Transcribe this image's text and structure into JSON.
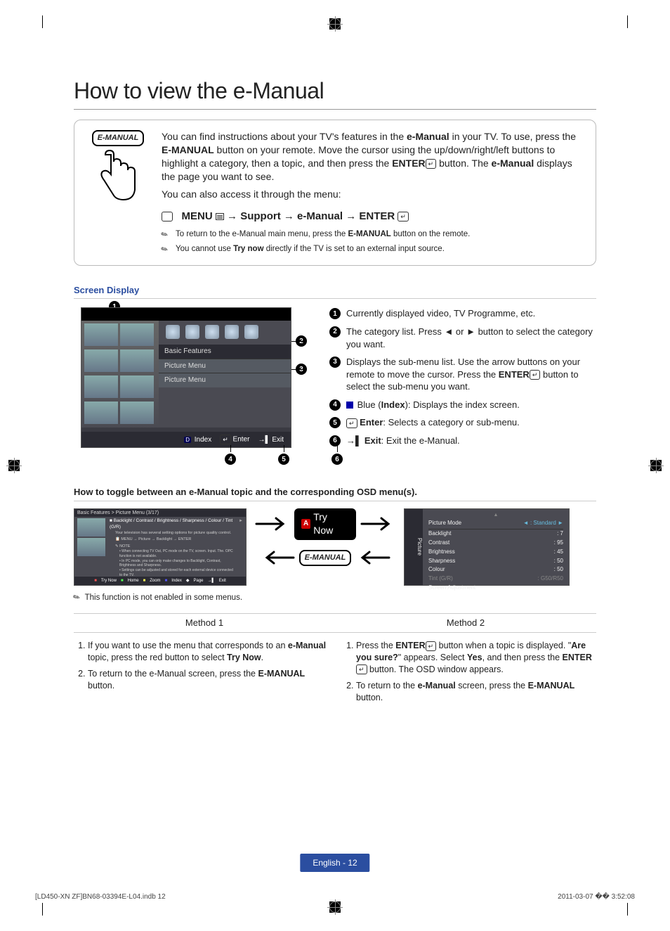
{
  "title": "How to view the e-Manual",
  "emanual_label": "E-MANUAL",
  "intro": {
    "p1_a": "You can find instructions about your TV's features in the ",
    "p1_b": "e-Manual",
    "p1_c": " in your TV. To use, press the ",
    "p1_d": "E-MANUAL",
    "p1_e": " button on your remote. Move the cursor using the up/down/right/left buttons to highlight a category, then a topic, and then press the ",
    "p1_f": "ENTER",
    "p1_g": " button. The ",
    "p1_h": "e-Manual",
    "p1_i": " displays the page you want to see.",
    "p2": "You can also access it through the menu:",
    "path": {
      "menu": "MENU",
      "support": "Support",
      "emanual": "e-Manual",
      "enter": "ENTER"
    },
    "note1_a": "To return to the e-Manual main menu, press the ",
    "note1_b": "E-MANUAL",
    "note1_c": " button on the remote.",
    "note2_a": "You cannot use ",
    "note2_b": "Try now",
    "note2_c": " directly if the TV is set to an external input source."
  },
  "screen_display_h": "Screen Display",
  "mock": {
    "basic": "Basic Features",
    "pm1": "Picture Menu",
    "pm2": "Picture Menu",
    "d": "D",
    "index": "Index",
    "e": "E",
    "enter": "Enter",
    "exit": "Exit"
  },
  "legend": {
    "i1": "Currently displayed video, TV Programme, etc.",
    "i2_a": "The category list. Press ◄ or ► button to select the category you want.",
    "i3_a": "Displays the sub-menu list. Use the arrow buttons on your remote to move the cursor. Press the ",
    "i3_b": "ENTER",
    "i3_c": " button to select the sub-menu you want.",
    "i4_a": "Blue (",
    "i4_b": "Index",
    "i4_c": "): Displays the index screen.",
    "i5_a": "Enter",
    "i5_b": ": Selects a category or sub-menu.",
    "i6_a": "Exit",
    "i6_b": ": Exit the e-Manual."
  },
  "toggle_h": "How to toggle between an e-Manual topic and the corresponding OSD menu(s).",
  "mini": {
    "breadcrumb": "Basic Features > Picture Menu (3/17)",
    "bullets": "Backlight / Contrast / Brightness / Sharpness / Colour / Tint (G/R)",
    "sub": "Your television has several setting options for picture quality control.",
    "path": "MENU → Picture → Backlight → ENTER",
    "note_h": "NOTE",
    "b1": "When connecting TV Out, PC mode on the TV, screen. Input. The. OPC function is not available.",
    "b2": "In PC mode, you can only make changes to Backlight, Contrast, Brightness and Sharpness.",
    "b3": "Settings can be adjusted and stored for each external device connected to the TV.",
    "ft_try": "Try Now",
    "ft_home": "Home",
    "ft_zoom": "Zoom",
    "ft_index": "Index",
    "ft_page": "Page",
    "ft_exit": "Exit"
  },
  "trynow_label": "Try Now",
  "osd": {
    "side": "Picture",
    "mode": "Picture Mode",
    "mode_v": ": Standard",
    "bl": "Backlight",
    "bl_v": ": 7",
    "ct": "Contrast",
    "ct_v": ": 95",
    "br": "Brightness",
    "br_v": ": 45",
    "sh": "Sharpness",
    "sh_v": ": 50",
    "co": "Colour",
    "co_v": ": 50",
    "ti": "Tint (G/R)",
    "ti_v": ": G50/R50",
    "sa": "Screen Adjustment"
  },
  "note3": "This function is not enabled in some menus.",
  "method1_h": "Method 1",
  "method2_h": "Method 2",
  "m1": {
    "s1_a": "If you want to use the menu that corresponds to an ",
    "s1_b": "e-Manual",
    "s1_c": " topic, press the red button to select ",
    "s1_d": "Try Now",
    "s1_e": ".",
    "s2_a": "To return to the e-Manual screen, press the ",
    "s2_b": "E-MANUAL",
    "s2_c": " button."
  },
  "m2": {
    "s1_a": "Press the ",
    "s1_b": "ENTER",
    "s1_c": " button when a topic is displayed. \"",
    "s1_d": "Are you sure?",
    "s1_e": "\" appears. Select ",
    "s1_f": "Yes",
    "s1_g": ", and then press the ",
    "s1_h": "ENTER",
    "s1_i": " button. The OSD window appears.",
    "s2_a": "To return to the ",
    "s2_b": "e-Manual",
    "s2_c": " screen, press the ",
    "s2_d": "E-MANUAL",
    "s2_e": " button."
  },
  "page_num": "English - 12",
  "footer_left": "[LD450-XN ZF]BN68-03394E-L04.indb   12",
  "footer_right": "2011-03-07   �� 3:52:08"
}
